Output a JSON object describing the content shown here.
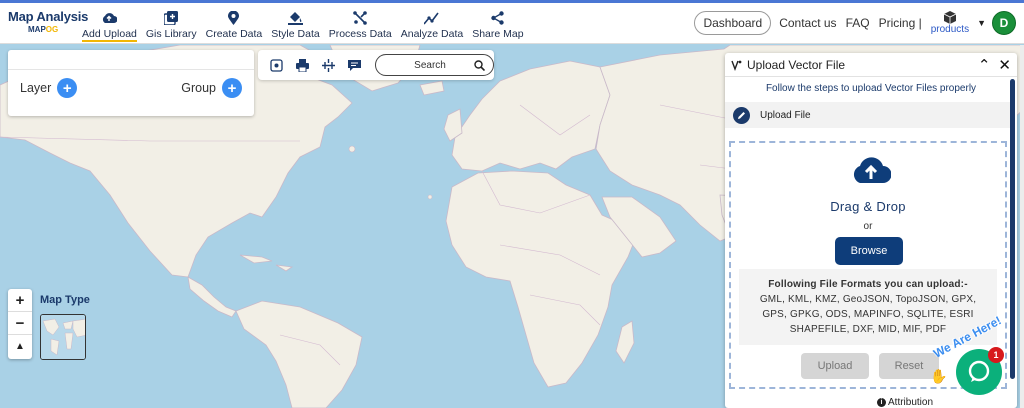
{
  "brand": {
    "title": "Map Analysis",
    "sub_left": "MAP",
    "sub_right": "OG"
  },
  "nav": [
    {
      "label": "Add Upload",
      "icon": "cloud-upload-icon",
      "active": true
    },
    {
      "label": "Gis Library",
      "icon": "library-icon"
    },
    {
      "label": "Create Data",
      "icon": "location-pin-icon"
    },
    {
      "label": "Style Data",
      "icon": "paint-bucket-icon"
    },
    {
      "label": "Process Data",
      "icon": "process-icon"
    },
    {
      "label": "Analyze Data",
      "icon": "analyze-icon"
    },
    {
      "label": "Share Map",
      "icon": "share-icon"
    }
  ],
  "right_nav": {
    "dashboard": "Dashboard",
    "contact": "Contact us",
    "faq": "FAQ",
    "pricing": "Pricing |",
    "products": "products",
    "avatar": "D"
  },
  "layer_panel": {
    "layer": "Layer",
    "group": "Group"
  },
  "toolbar": {
    "search_placeholder": "Search"
  },
  "map_type": {
    "label": "Map Type"
  },
  "upload_panel": {
    "title": "Upload Vector File",
    "subtitle": "Follow the steps to upload Vector Files properly",
    "step": "Upload File",
    "drag_drop": "Drag & Drop",
    "or": "or",
    "browse": "Browse",
    "formats_title": "Following File Formats you can upload:-",
    "formats_line1": "GML, KML, KMZ, GeoJSON, TopoJSON, GPX,",
    "formats_line2": "GPS, GPKG, ODS, MAPINFO, SQLITE, ESRI",
    "formats_line3": "SHAPEFILE, DXF, MID, MIF, PDF",
    "upload_btn": "Upload",
    "reset_btn": "Reset"
  },
  "chat": {
    "badge": "1",
    "tagline": "We Are Here!"
  },
  "attribution": "Attribution",
  "colors": {
    "accent": "#1b3a6b",
    "active_underline": "#f2b705",
    "ocean": "#a9d1e6",
    "land": "#f2efe6",
    "chat": "#0bb07b"
  }
}
